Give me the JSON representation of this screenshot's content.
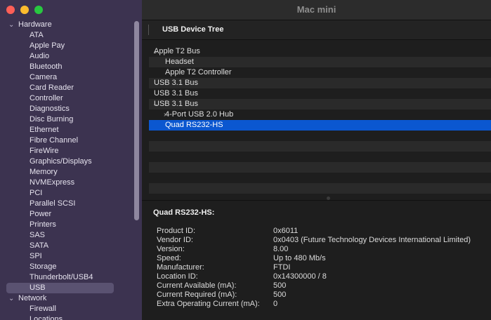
{
  "window": {
    "title": "Mac mini"
  },
  "sidebar": {
    "sections": [
      {
        "label": "Hardware",
        "items": [
          "ATA",
          "Apple Pay",
          "Audio",
          "Bluetooth",
          "Camera",
          "Card Reader",
          "Controller",
          "Diagnostics",
          "Disc Burning",
          "Ethernet",
          "Fibre Channel",
          "FireWire",
          "Graphics/Displays",
          "Memory",
          "NVMExpress",
          "PCI",
          "Parallel SCSI",
          "Power",
          "Printers",
          "SAS",
          "SATA",
          "SPI",
          "Storage",
          "Thunderbolt/USB4",
          "USB"
        ]
      },
      {
        "label": "Network",
        "items": [
          "Firewall",
          "Locations"
        ]
      }
    ],
    "selected": "USB"
  },
  "content": {
    "header": "USB Device Tree",
    "tree": [
      {
        "label": "Apple T2 Bus",
        "level": 0,
        "expanded": true
      },
      {
        "label": "Headset",
        "level": 1
      },
      {
        "label": "Apple T2 Controller",
        "level": 1
      },
      {
        "label": "USB 3.1 Bus",
        "level": 0
      },
      {
        "label": "USB 3.1 Bus",
        "level": 0
      },
      {
        "label": "USB 3.1 Bus",
        "level": 0,
        "expanded": true
      },
      {
        "label": "4-Port USB 2.0 Hub",
        "level": 1,
        "collapsed": true
      },
      {
        "label": "Quad RS232-HS",
        "level": 1,
        "selected": true
      }
    ],
    "details": {
      "title": "Quad RS232-HS:",
      "rows": [
        {
          "key": "Product ID:",
          "value": "0x6011"
        },
        {
          "key": "Vendor ID:",
          "value": "0x0403  (Future Technology Devices International Limited)"
        },
        {
          "key": "Version:",
          "value": "8.00"
        },
        {
          "key": "Speed:",
          "value": "Up to 480 Mb/s"
        },
        {
          "key": "Manufacturer:",
          "value": "FTDI"
        },
        {
          "key": "Location ID:",
          "value": "0x14300000 / 8"
        },
        {
          "key": "Current Available (mA):",
          "value": "500"
        },
        {
          "key": "Current Required (mA):",
          "value": "500"
        },
        {
          "key": "Extra Operating Current (mA):",
          "value": "0"
        }
      ]
    }
  }
}
